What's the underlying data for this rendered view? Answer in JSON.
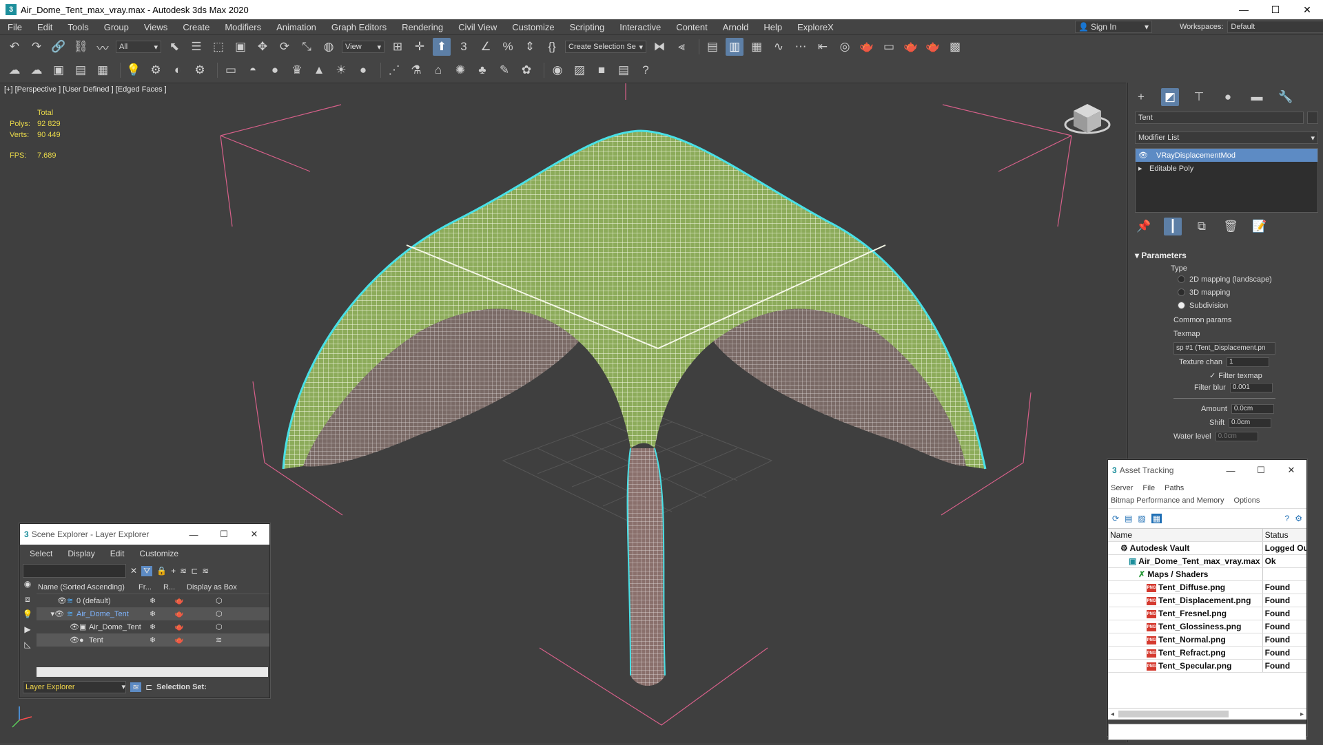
{
  "window": {
    "title": "Air_Dome_Tent_max_vray.max - Autodesk 3ds Max 2020",
    "minimize": "—",
    "maximize": "☐",
    "close": "✕"
  },
  "menu": [
    "File",
    "Edit",
    "Tools",
    "Group",
    "Views",
    "Create",
    "Modifiers",
    "Animation",
    "Graph Editors",
    "Rendering",
    "Civil View",
    "Customize",
    "Scripting",
    "Interactive",
    "Content",
    "Arnold",
    "Help",
    "ExploreX"
  ],
  "account": {
    "sign_in": "Sign In",
    "workspaces_label": "Workspaces:",
    "workspace_value": "Default"
  },
  "toolbar": {
    "filter_all": "All",
    "ref_coord": "View",
    "create_selection_set": "Create Selection Se"
  },
  "viewport": {
    "label": "[+] [Perspective ] [User Defined ] [Edged Faces ]",
    "stats": {
      "total_label": "Total",
      "polys_label": "Polys:",
      "polys": "92 829",
      "verts_label": "Verts:",
      "verts": "90 449",
      "fps_label": "FPS:",
      "fps": "7.689"
    }
  },
  "command_panel": {
    "object_name": "Tent",
    "modifier_list": "Modifier List",
    "stack": [
      "VRayDisplacementMod",
      "Editable Poly"
    ],
    "parameters": {
      "rollout": "Parameters",
      "type_label": "Type",
      "types": [
        "2D mapping (landscape)",
        "3D mapping",
        "Subdivision"
      ],
      "selected_type": 2,
      "common_params": "Common params",
      "texmap_label": "Texmap",
      "texmap_value": "sp #1 (Tent_Displacement.pn",
      "texture_chan_label": "Texture chan",
      "texture_chan": "1",
      "filter_texmap": "Filter texmap",
      "filter_blur_label": "Filter blur",
      "filter_blur": "0.001",
      "amount_label": "Amount",
      "amount": "0.0cm",
      "shift_label": "Shift",
      "shift": "0.0cm",
      "water_level_label": "Water level",
      "water_level": "0.0cm"
    }
  },
  "scene_explorer": {
    "title": "Scene Explorer - Layer Explorer",
    "menu": [
      "Select",
      "Display",
      "Edit",
      "Customize"
    ],
    "columns": [
      "Name (Sorted Ascending)",
      "Fr...",
      "R...",
      "Display as Box"
    ],
    "rows": [
      {
        "name": "0 (default)",
        "indent": 0
      },
      {
        "name": "Air_Dome_Tent",
        "indent": 0
      },
      {
        "name": "Air_Dome_Tent",
        "indent": 1
      },
      {
        "name": "Tent",
        "indent": 1
      }
    ],
    "footer_explorer": "Layer Explorer",
    "selection_set": "Selection Set:"
  },
  "asset_tracking": {
    "title": "Asset Tracking",
    "menu1": [
      "Server",
      "File",
      "Paths"
    ],
    "menu2": [
      "Bitmap Performance and Memory",
      "Options"
    ],
    "columns": [
      "Name",
      "Status"
    ],
    "rows": [
      {
        "name": "Autodesk Vault",
        "status": "Logged Ou",
        "type": "vault"
      },
      {
        "name": "Air_Dome_Tent_max_vray.max",
        "status": "Ok",
        "type": "max"
      },
      {
        "name": "Maps / Shaders",
        "status": "",
        "type": "folder"
      },
      {
        "name": "Tent_Diffuse.png",
        "status": "Found",
        "type": "png"
      },
      {
        "name": "Tent_Displacement.png",
        "status": "Found",
        "type": "png"
      },
      {
        "name": "Tent_Fresnel.png",
        "status": "Found",
        "type": "png"
      },
      {
        "name": "Tent_Glossiness.png",
        "status": "Found",
        "type": "png"
      },
      {
        "name": "Tent_Normal.png",
        "status": "Found",
        "type": "png"
      },
      {
        "name": "Tent_Refract.png",
        "status": "Found",
        "type": "png"
      },
      {
        "name": "Tent_Specular.png",
        "status": "Found",
        "type": "png"
      }
    ]
  }
}
